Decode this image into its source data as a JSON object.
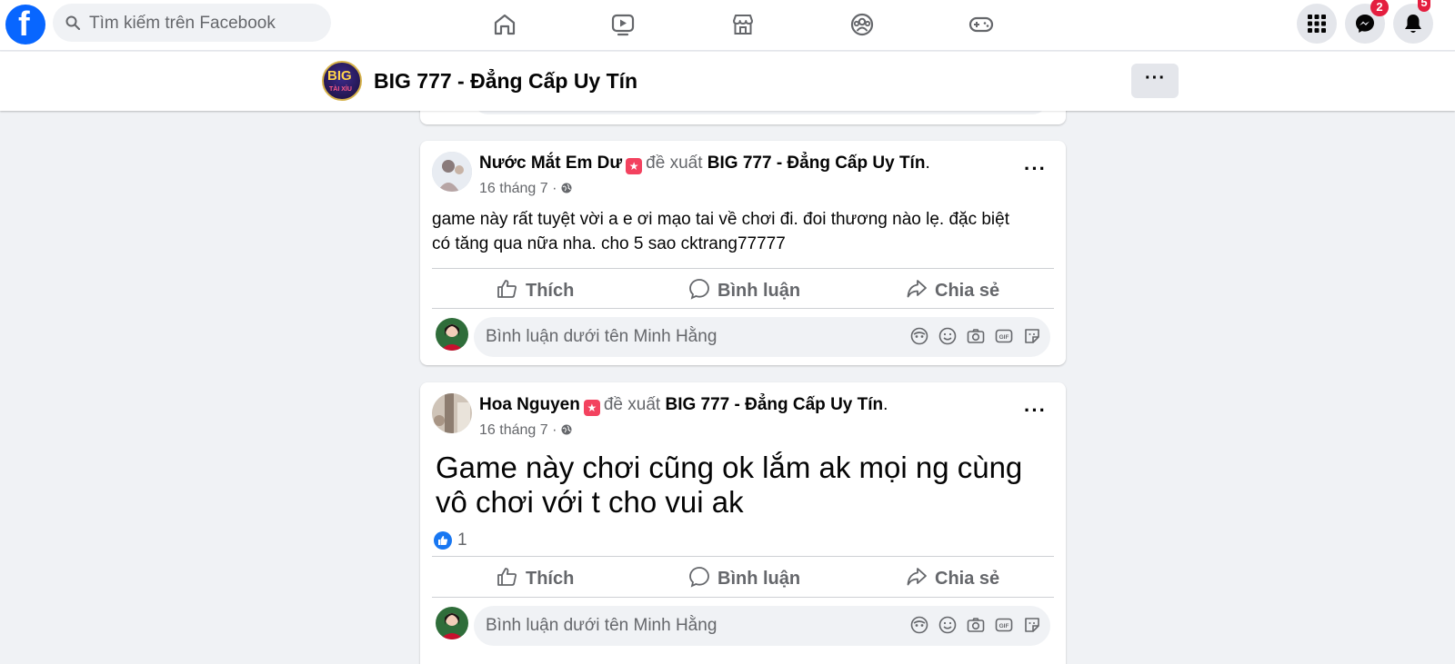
{
  "topbar": {
    "logo": "f",
    "search_placeholder": "Tìm kiếm trên Facebook",
    "nav_icons": [
      "home-icon",
      "video-icon",
      "marketplace-icon",
      "groups-icon",
      "gaming-icon"
    ],
    "messenger_badge": "2",
    "notifications_badge": "5"
  },
  "page": {
    "title": "BIG 777 - Đẳng Cấp Uy Tín",
    "avatar_text": "BIG",
    "avatar_subtext": "TÀI XỈU",
    "more_label": "···"
  },
  "posts": [
    {
      "author": "Nước Mắt Em Dư",
      "recommend_word": "đề xuất",
      "page_name": "BIG 777 - Đẳng Cấp Uy Tín",
      "date": "16 tháng 7 ·",
      "text_line1": "game này rất tuyệt vời a e ơi mạo tai về chơi đi. đoi thương nào lẹ. đặc biệt",
      "text_line2": "có tăng qua nữa nha.  cho 5 sao cktrang77777",
      "like_label": "Thích",
      "comment_label": "Bình luận",
      "share_label": "Chia sẻ",
      "comment_placeholder": "Bình luận dưới tên Minh Hằng"
    },
    {
      "author": "Hoa Nguyen",
      "recommend_word": "đề xuất",
      "page_name": "BIG 777 - Đẳng Cấp Uy Tín",
      "date": "16 tháng 7 ·",
      "text_line1": "Game này chơi cũng ok lắm ak mọi ng cùng",
      "text_line2": "vô chơi với t cho vui ak",
      "reaction_count": "1",
      "like_label": "Thích",
      "comment_label": "Bình luận",
      "share_label": "Chia sẻ",
      "comment_placeholder": "Bình luận dưới tên Minh Hằng"
    }
  ],
  "colors": {
    "brand": "#0866ff",
    "background": "#f0f2f5",
    "muted_text": "#65676b",
    "badge_red": "#e41e3f"
  }
}
